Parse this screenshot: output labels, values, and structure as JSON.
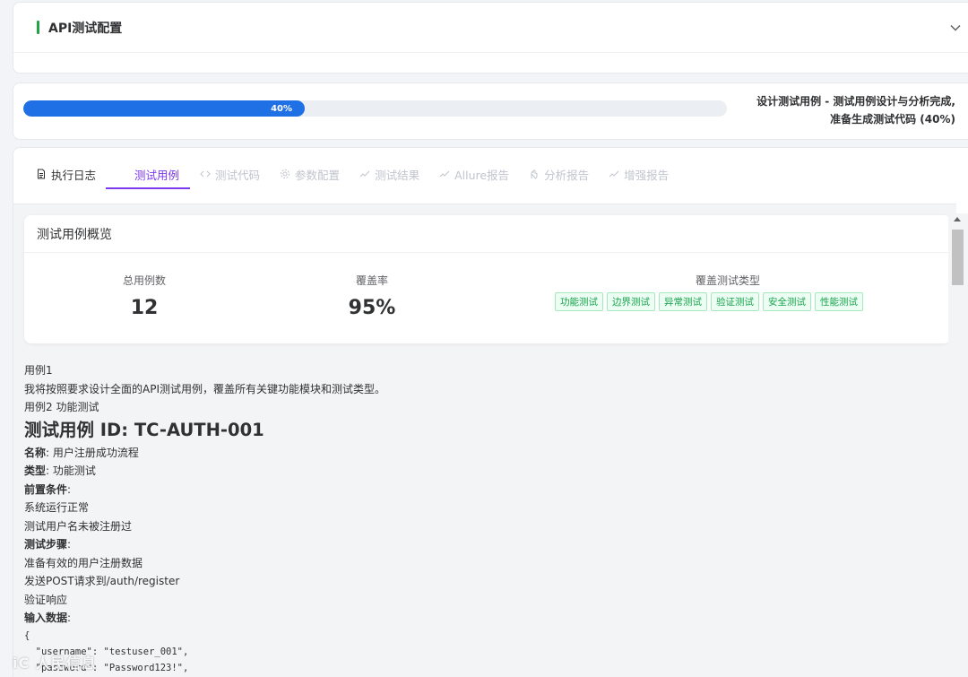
{
  "config": {
    "title": "API测试配置"
  },
  "progress": {
    "percent": 40,
    "label": "40%",
    "status_line1": "设计测试用例 - 测试用例设计与分析完成,",
    "status_line2": "准备生成测试代码 (40%)"
  },
  "tabs": [
    {
      "label": "执行日志",
      "icon": "document-icon"
    },
    {
      "label": "测试用例",
      "icon": "none"
    },
    {
      "label": "测试代码",
      "icon": "code-icon"
    },
    {
      "label": "参数配置",
      "icon": "gear-icon"
    },
    {
      "label": "测试结果",
      "icon": "trend-icon"
    },
    {
      "label": "Allure报告",
      "icon": "trend-icon"
    },
    {
      "label": "分析报告",
      "icon": "hand-icon"
    },
    {
      "label": "增强报告",
      "icon": "trend-icon"
    }
  ],
  "overview": {
    "title": "测试用例概览",
    "total_label": "总用例数",
    "total_value": "12",
    "coverage_label": "覆盖率",
    "coverage_value": "95%",
    "types_label": "覆盖测试类型",
    "types": [
      "功能测试",
      "边界测试",
      "异常测试",
      "验证测试",
      "安全测试",
      "性能测试"
    ],
    "tag_color": "#16a34a"
  },
  "content": {
    "line1": "用例1",
    "line2": "我将按照要求设计全面的API测试用例，覆盖所有关键功能模块和测试类型。",
    "line3": "用例2 功能测试",
    "heading": "测试用例 ID: TC-AUTH-001",
    "name_key": "名称",
    "name_value": ": 用户注册成功流程",
    "type_key": "类型",
    "type_value": ": 功能测试",
    "precond_key": "前置条件",
    "precond_colon": ":",
    "precond_1": "系统运行正常",
    "precond_2": "测试用户名未被注册过",
    "steps_key": "测试步骤",
    "steps_colon": ":",
    "step_1": "准备有效的用户注册数据",
    "step_2": "发送POST请求到/auth/register",
    "step_3": "验证响应",
    "input_key": "输入数据",
    "input_colon": ":",
    "code_1": "{",
    "code_2": "  \"username\": \"testuser_001\",",
    "code_3": "  \"password\": \"Password123!\","
  },
  "watermark": "iC 人民信息",
  "accent_color": "#7c3aed",
  "progress_color": "#1f6fe5"
}
